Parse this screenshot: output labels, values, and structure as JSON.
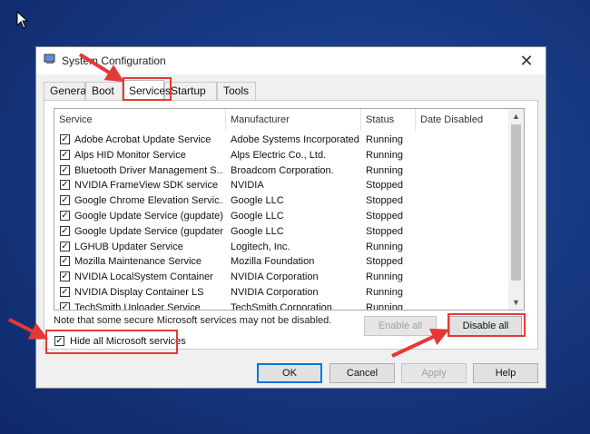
{
  "window": {
    "title": "System Configuration"
  },
  "tabs": [
    {
      "label": "General"
    },
    {
      "label": "Boot"
    },
    {
      "label": "Services"
    },
    {
      "label": "Startup"
    },
    {
      "label": "Tools"
    }
  ],
  "services_table": {
    "headers": {
      "service": "Service",
      "manufacturer": "Manufacturer",
      "status": "Status",
      "date_disabled": "Date Disabled"
    },
    "rows": [
      {
        "checked": true,
        "service": "Adobe Acrobat Update Service",
        "manufacturer": "Adobe Systems Incorporated",
        "status": "Running"
      },
      {
        "checked": true,
        "service": "Alps HID Monitor Service",
        "manufacturer": "Alps Electric Co., Ltd.",
        "status": "Running"
      },
      {
        "checked": true,
        "service": "Bluetooth Driver Management S...",
        "manufacturer": "Broadcom Corporation.",
        "status": "Running"
      },
      {
        "checked": true,
        "service": "NVIDIA FrameView SDK service",
        "manufacturer": "NVIDIA",
        "status": "Stopped"
      },
      {
        "checked": true,
        "service": "Google Chrome Elevation Servic...",
        "manufacturer": "Google LLC",
        "status": "Stopped"
      },
      {
        "checked": true,
        "service": "Google Update Service (gupdate)",
        "manufacturer": "Google LLC",
        "status": "Stopped"
      },
      {
        "checked": true,
        "service": "Google Update Service (gupdatem)",
        "manufacturer": "Google LLC",
        "status": "Stopped"
      },
      {
        "checked": true,
        "service": "LGHUB Updater Service",
        "manufacturer": "Logitech, Inc.",
        "status": "Running"
      },
      {
        "checked": true,
        "service": "Mozilla Maintenance Service",
        "manufacturer": "Mozilla Foundation",
        "status": "Stopped"
      },
      {
        "checked": true,
        "service": "NVIDIA LocalSystem Container",
        "manufacturer": "NVIDIA Corporation",
        "status": "Running"
      },
      {
        "checked": true,
        "service": "NVIDIA Display Container LS",
        "manufacturer": "NVIDIA Corporation",
        "status": "Running"
      },
      {
        "checked": true,
        "service": "TechSmith Uploader Service",
        "manufacturer": "TechSmith Corporation",
        "status": "Running"
      }
    ]
  },
  "note": "Note that some secure Microsoft services may not be disabled.",
  "buttons": {
    "enable_all": "Enable all",
    "disable_all": "Disable all",
    "ok": "OK",
    "cancel": "Cancel",
    "apply": "Apply",
    "help": "Help"
  },
  "hide_ms": {
    "label": "Hide all Microsoft services",
    "checked": true
  },
  "colors": {
    "desktop": "#173a83",
    "highlight": "#e53935",
    "focus": "#0078d7"
  }
}
